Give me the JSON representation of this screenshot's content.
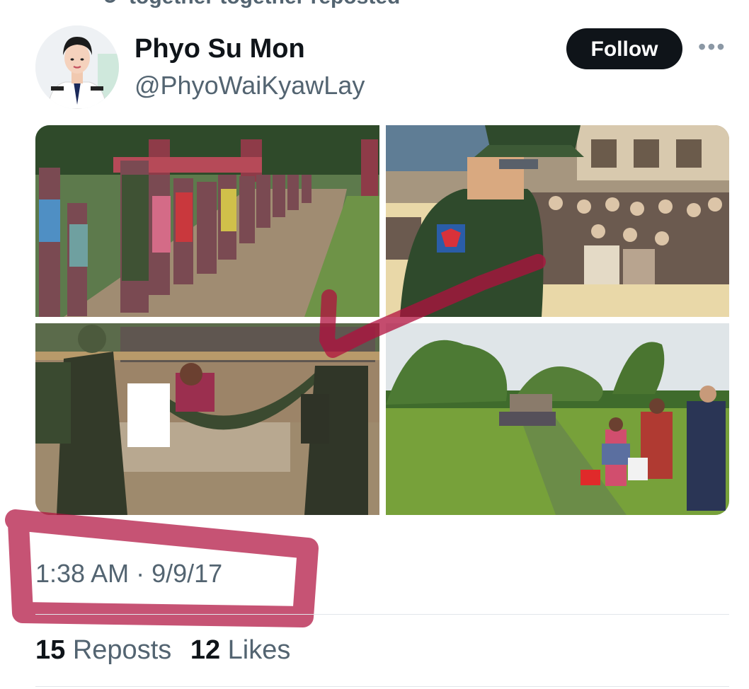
{
  "context": {
    "text": "together together reposted",
    "icon": "repost-icon"
  },
  "author": {
    "name": "Phyo Su Mon",
    "handle": "@PhyoWaiKyawLay"
  },
  "actions": {
    "follow_label": "Follow",
    "more_label": "•••"
  },
  "timestamp": "1:38 AM · 9/9/17",
  "stats": {
    "reposts_count": "15",
    "reposts_label": "Reposts",
    "likes_count": "12",
    "likes_label": "Likes"
  },
  "colors": {
    "highlight": "#c2185b",
    "follow_bg": "#0f1419",
    "muted": "#536471"
  }
}
